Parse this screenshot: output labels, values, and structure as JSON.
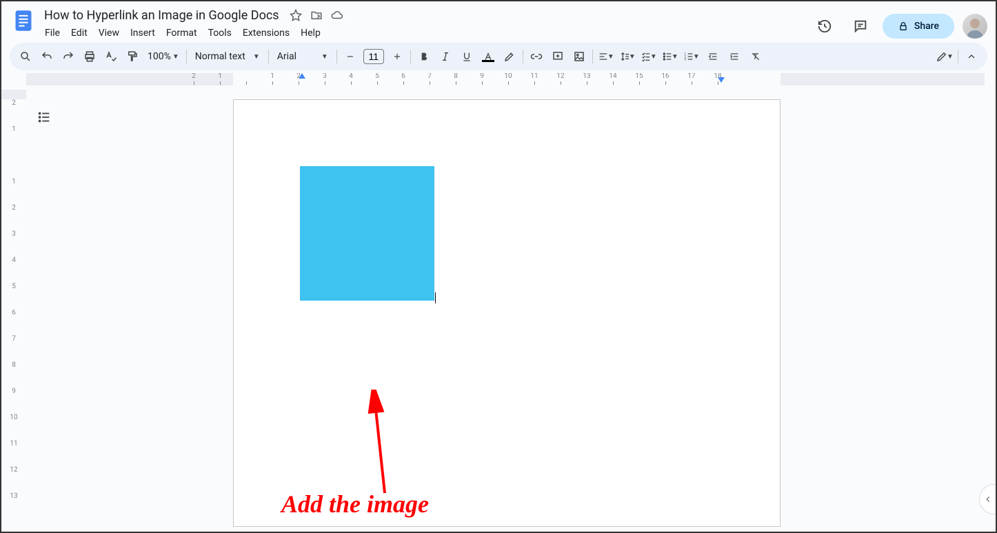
{
  "document": {
    "title": "How to Hyperlink an Image in Google Docs"
  },
  "menus": {
    "file": "File",
    "edit": "Edit",
    "view": "View",
    "insert": "Insert",
    "format": "Format",
    "tools": "Tools",
    "extensions": "Extensions",
    "help": "Help"
  },
  "header_actions": {
    "share_label": "Share"
  },
  "toolbar": {
    "zoom": "100%",
    "paragraph_style": "Normal text",
    "font_family": "Arial",
    "font_size": "11"
  },
  "ruler_h_labels": [
    "2",
    "1",
    "",
    "1",
    "2",
    "3",
    "4",
    "5",
    "6",
    "7",
    "8",
    "9",
    "10",
    "11",
    "12",
    "13",
    "14",
    "15",
    "16",
    "17",
    "18"
  ],
  "ruler_v_labels": [
    "2",
    "1",
    "",
    "1",
    "2",
    "3",
    "4",
    "5",
    "6",
    "7",
    "8",
    "9",
    "10",
    "11",
    "12",
    "13"
  ],
  "annotation": {
    "text": "Add the image"
  }
}
